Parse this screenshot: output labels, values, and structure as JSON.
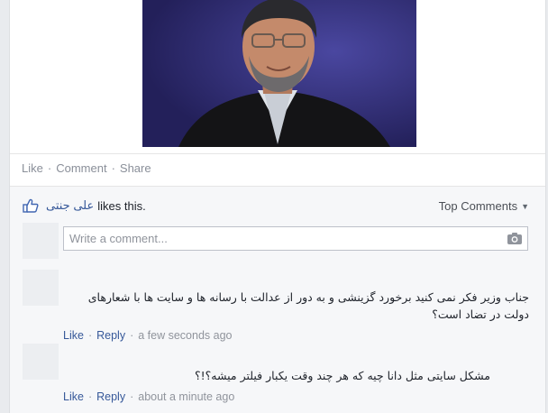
{
  "post": {
    "actions": {
      "like": "Like",
      "comment": "Comment",
      "share": "Share",
      "separator": "·"
    }
  },
  "ufi": {
    "likes": {
      "liker_name": "علی جنتی",
      "suffix": "likes this."
    },
    "sort_label": "Top Comments",
    "comment_input": {
      "placeholder": "Write a comment..."
    },
    "comments": [
      {
        "text": "جناب وزیر فکر نمی کنید برخورد گزینشی و به دور از عدالت با رسانه ها و سایت ها با شعارهای دولت در تضاد است؟",
        "like": "Like",
        "reply": "Reply",
        "time": "a few seconds ago"
      },
      {
        "text": "مشکل سایتی مثل دانا چیه که هر چند وقت یکبار فیلتر میشه؟!؟",
        "like": "Like",
        "reply": "Reply",
        "time": "about a minute ago"
      }
    ]
  },
  "colors": {
    "link": "#365899",
    "meta": "#90949c",
    "photo_bg": "#2f2c78"
  },
  "icons": [
    "thumbs-up-icon",
    "camera-icon",
    "chevron-down-icon"
  ]
}
